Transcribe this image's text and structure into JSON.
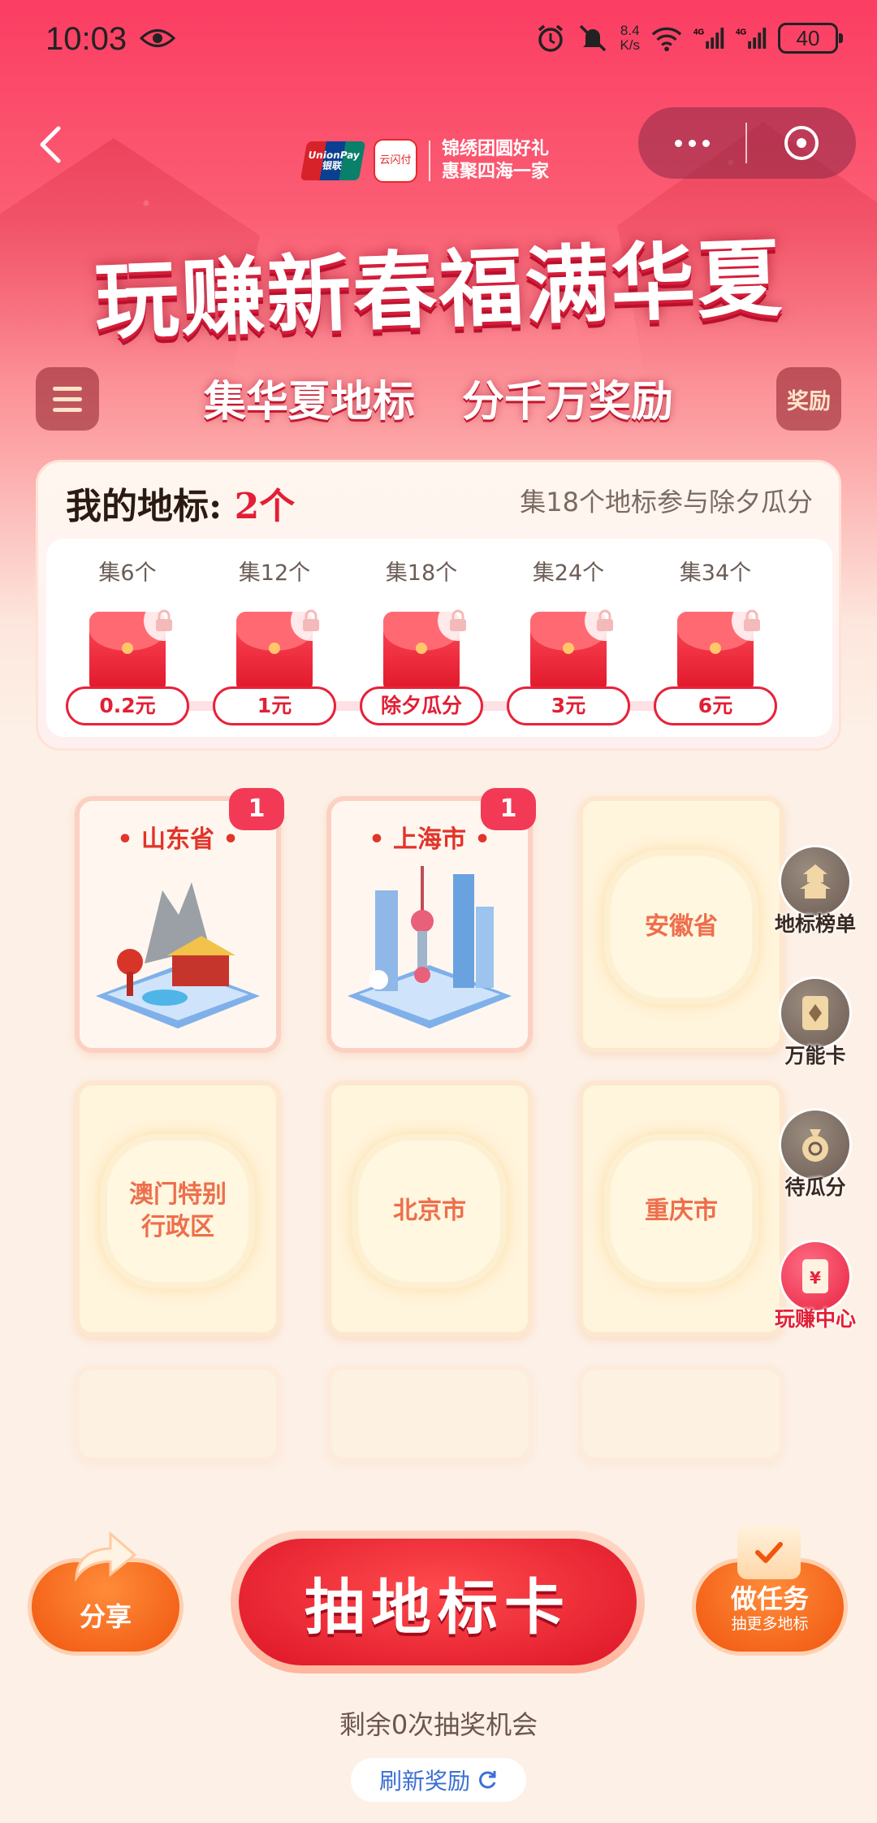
{
  "status_bar": {
    "time": "10:03",
    "net_speed_value": "8.4",
    "net_speed_unit": "K/s",
    "signal_1": "4G",
    "signal_2": "4G",
    "battery": "40"
  },
  "header": {
    "logo_unionpay": "UnionPay 银联",
    "logo_yunshanfu": "云闪付",
    "slogan_line1": "锦绣团圆好礼",
    "slogan_line2": "惠聚四海一家"
  },
  "banner": {
    "title": "玩赚新春福满华夏",
    "subtitle": "集华夏地标 分千万奖励",
    "reward_button": "奖励"
  },
  "panel": {
    "label": "我的地标:",
    "count": "2个",
    "tip": "集18个地标参与除夕瓜分",
    "tiers": [
      {
        "label": "集6个",
        "prize": "0.2元"
      },
      {
        "label": "集12个",
        "prize": "1元"
      },
      {
        "label": "集18个",
        "prize": "除夕瓜分"
      },
      {
        "label": "集24个",
        "prize": "3元"
      },
      {
        "label": "集34个",
        "prize": "6元"
      }
    ]
  },
  "cards": [
    {
      "name": "山东省",
      "owned": true,
      "badge": "1",
      "title_display": "• 山东省 •"
    },
    {
      "name": "上海市",
      "owned": true,
      "badge": "1",
      "title_display": "• 上海市 •"
    },
    {
      "name": "安徽省",
      "owned": false
    },
    {
      "name": "澳门特别行政区",
      "owned": false,
      "line1": "澳门特别",
      "line2": "行政区"
    },
    {
      "name": "北京市",
      "owned": false
    },
    {
      "name": "重庆市",
      "owned": false
    }
  ],
  "side_menu": [
    {
      "label": "地标榜单",
      "icon": "pagoda-icon"
    },
    {
      "label": "万能卡",
      "icon": "card-icon"
    },
    {
      "label": "待瓜分",
      "icon": "money-bag-icon"
    },
    {
      "label": "玩赚中心",
      "icon": "red-envelope-icon"
    }
  ],
  "actions": {
    "share": "分享",
    "draw": "抽地标卡",
    "task_main": "做任务",
    "task_sub": "抽更多地标",
    "remaining": "剩余0次抽奖机会",
    "refresh": "刷新奖励"
  },
  "colors": {
    "primary_red": "#e21f36",
    "accent_orange": "#f0560f",
    "bg_cream": "#fdf0e6"
  }
}
